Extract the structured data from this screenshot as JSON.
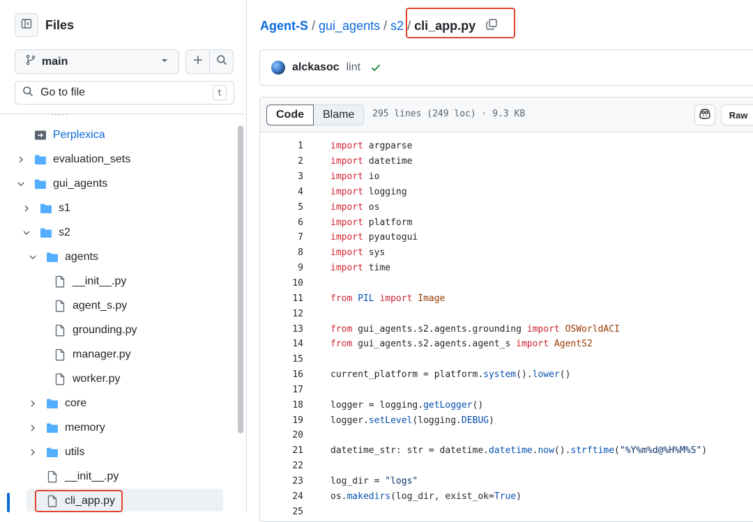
{
  "sidebar": {
    "title": "Files",
    "branch": "main",
    "goto_placeholder": "Go to file",
    "goto_shortcut": "t",
    "tree": [
      {
        "label": "Perplexica",
        "type": "submodule",
        "depth": 1
      },
      {
        "label": "evaluation_sets",
        "type": "folder",
        "depth": 1,
        "expanded": false
      },
      {
        "label": "gui_agents",
        "type": "folder",
        "depth": 1,
        "expanded": true
      },
      {
        "label": "s1",
        "type": "folder",
        "depth": 2,
        "expanded": false
      },
      {
        "label": "s2",
        "type": "folder",
        "depth": 2,
        "expanded": true
      },
      {
        "label": "agents",
        "type": "folder",
        "depth": 3,
        "expanded": true
      },
      {
        "label": "__init__.py",
        "type": "file",
        "depth": 4
      },
      {
        "label": "agent_s.py",
        "type": "file",
        "depth": 4
      },
      {
        "label": "grounding.py",
        "type": "file",
        "depth": 4
      },
      {
        "label": "manager.py",
        "type": "file",
        "depth": 4
      },
      {
        "label": "worker.py",
        "type": "file",
        "depth": 4
      },
      {
        "label": "core",
        "type": "folder",
        "depth": 3,
        "expanded": false
      },
      {
        "label": "memory",
        "type": "folder",
        "depth": 3,
        "expanded": false
      },
      {
        "label": "utils",
        "type": "folder",
        "depth": 3,
        "expanded": false
      },
      {
        "label": "__init__.py",
        "type": "file",
        "depth": 3
      },
      {
        "label": "cli_app.py",
        "type": "file",
        "depth": 3,
        "selected": true
      }
    ]
  },
  "breadcrumb": {
    "repo": "Agent-S",
    "parts": [
      "gui_agents",
      "s2"
    ],
    "current": "cli_app.py"
  },
  "commit": {
    "author": "alckasoc",
    "message": "lint"
  },
  "file": {
    "tab_code": "Code",
    "tab_blame": "Blame",
    "info": "295 lines (249 loc) · 9.3 KB",
    "raw_label": "Raw"
  },
  "colors": {
    "accent": "#0969da",
    "highlight_box": "#e0432f",
    "keyword": "#cf222e",
    "success": "#1a7f37"
  },
  "code_lines": [
    {
      "n": "1",
      "t": [
        [
          "kw",
          "import"
        ],
        [
          "",
          " argparse"
        ]
      ]
    },
    {
      "n": "2",
      "t": [
        [
          "kw",
          "import"
        ],
        [
          "",
          " datetime"
        ]
      ]
    },
    {
      "n": "3",
      "t": [
        [
          "kw",
          "import"
        ],
        [
          "",
          " io"
        ]
      ]
    },
    {
      "n": "4",
      "t": [
        [
          "kw",
          "import"
        ],
        [
          "",
          " logging"
        ]
      ]
    },
    {
      "n": "5",
      "t": [
        [
          "kw",
          "import"
        ],
        [
          "",
          " os"
        ]
      ]
    },
    {
      "n": "6",
      "t": [
        [
          "kw",
          "import"
        ],
        [
          "",
          " platform"
        ]
      ]
    },
    {
      "n": "7",
      "t": [
        [
          "kw",
          "import"
        ],
        [
          "",
          " pyautogui"
        ]
      ]
    },
    {
      "n": "8",
      "t": [
        [
          "kw",
          "import"
        ],
        [
          "",
          " sys"
        ]
      ]
    },
    {
      "n": "9",
      "t": [
        [
          "kw",
          "import"
        ],
        [
          "",
          " time"
        ]
      ]
    },
    {
      "n": "10",
      "t": []
    },
    {
      "n": "11",
      "t": [
        [
          "kw",
          "from"
        ],
        [
          "",
          " "
        ],
        [
          "fn",
          "PIL"
        ],
        [
          "",
          " "
        ],
        [
          "kw",
          "import"
        ],
        [
          "",
          " "
        ],
        [
          "cls",
          "Image"
        ]
      ]
    },
    {
      "n": "12",
      "t": []
    },
    {
      "n": "13",
      "t": [
        [
          "kw",
          "from"
        ],
        [
          "",
          " gui_agents.s2.agents.grounding "
        ],
        [
          "kw",
          "import"
        ],
        [
          "",
          " "
        ],
        [
          "cls",
          "OSWorldACI"
        ]
      ]
    },
    {
      "n": "14",
      "t": [
        [
          "kw",
          "from"
        ],
        [
          "",
          " gui_agents.s2.agents.agent_s "
        ],
        [
          "kw",
          "import"
        ],
        [
          "",
          " "
        ],
        [
          "cls",
          "AgentS2"
        ]
      ]
    },
    {
      "n": "15",
      "t": []
    },
    {
      "n": "16",
      "t": [
        [
          "",
          "current_platform = platform."
        ],
        [
          "fn",
          "system"
        ],
        [
          "",
          "()."
        ],
        [
          "fn",
          "lower"
        ],
        [
          "",
          "()"
        ]
      ]
    },
    {
      "n": "17",
      "t": []
    },
    {
      "n": "18",
      "t": [
        [
          "",
          "logger = logging."
        ],
        [
          "fn",
          "getLogger"
        ],
        [
          "",
          "()"
        ]
      ]
    },
    {
      "n": "19",
      "t": [
        [
          "",
          "logger."
        ],
        [
          "fn",
          "setLevel"
        ],
        [
          "",
          "(logging."
        ],
        [
          "fn",
          "DEBUG"
        ],
        [
          "",
          ")"
        ]
      ]
    },
    {
      "n": "20",
      "t": []
    },
    {
      "n": "21",
      "t": [
        [
          "",
          "datetime_str: str = datetime."
        ],
        [
          "fn",
          "datetime"
        ],
        [
          "",
          "."
        ],
        [
          "fn",
          "now"
        ],
        [
          "",
          "()."
        ],
        [
          "fn",
          "strftime"
        ],
        [
          "",
          "("
        ],
        [
          "str",
          "\"%Y%m%d@%H%M%S\""
        ],
        [
          "",
          ")"
        ]
      ]
    },
    {
      "n": "22",
      "t": []
    },
    {
      "n": "23",
      "t": [
        [
          "",
          "log_dir = "
        ],
        [
          "str",
          "\"logs\""
        ]
      ]
    },
    {
      "n": "24",
      "t": [
        [
          "",
          "os."
        ],
        [
          "fn",
          "makedirs"
        ],
        [
          "",
          "(log_dir, exist_ok="
        ],
        [
          "fn",
          "True"
        ],
        [
          "",
          ")"
        ]
      ]
    },
    {
      "n": "25",
      "t": []
    }
  ]
}
